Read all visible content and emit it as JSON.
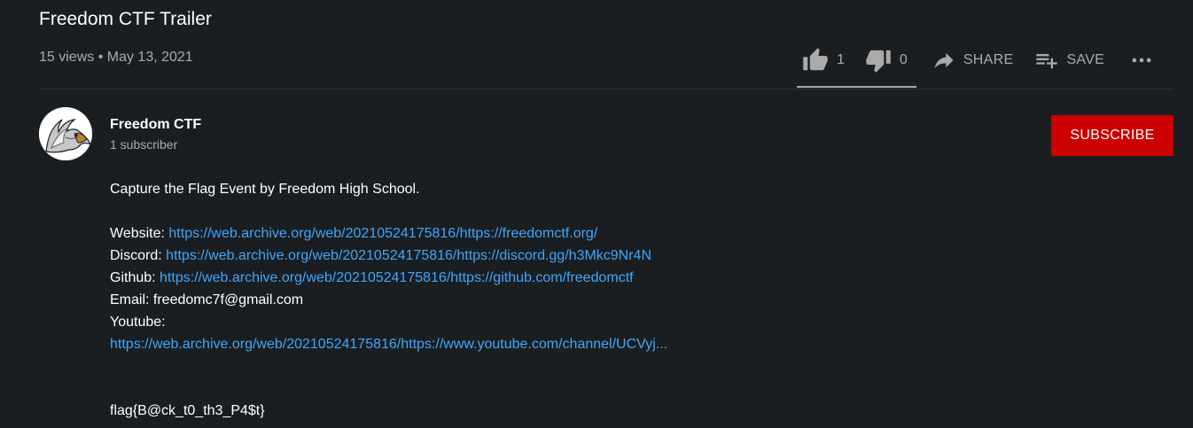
{
  "video": {
    "title": "Freedom CTF Trailer",
    "meta": "15 views • May 13, 2021"
  },
  "actions": {
    "like_count": "1",
    "dislike_count": "0",
    "share_label": "SHARE",
    "save_label": "SAVE",
    "like_icon": "thumb-up-icon",
    "dislike_icon": "thumb-down-icon",
    "share_icon": "share-arrow-icon",
    "save_icon": "playlist-add-icon",
    "more_icon": "more-horizontal-icon"
  },
  "channel": {
    "name": "Freedom CTF",
    "subscribers": "1 subscriber",
    "avatar_icon": "eagle-logo"
  },
  "subscribe_label": "SUBSCRIBE",
  "description": {
    "intro": "Capture the Flag Event by Freedom High School.",
    "website_label": "Website: ",
    "website_url": "https://web.archive.org/web/20210524175816/https://freedomctf.org/",
    "discord_label": "Discord: ",
    "discord_url": "https://web.archive.org/web/20210524175816/https://discord.gg/h3Mkc9Nr4N",
    "github_label": "Github: ",
    "github_url": "https://web.archive.org/web/20210524175816/https://github.com/freedomctf",
    "email": "Email: freedomc7f@gmail.com",
    "youtube_label": "Youtube:",
    "youtube_url": "https://web.archive.org/web/20210524175816/https://www.youtube.com/channel/UCVyj...",
    "flag": "flag{B@ck_t0_th3_P4$t}"
  },
  "colors": {
    "background": "#1b1e20",
    "link": "#3ea6ff",
    "subscribe": "#cc0000",
    "secondary_text": "#aaaaaa"
  }
}
